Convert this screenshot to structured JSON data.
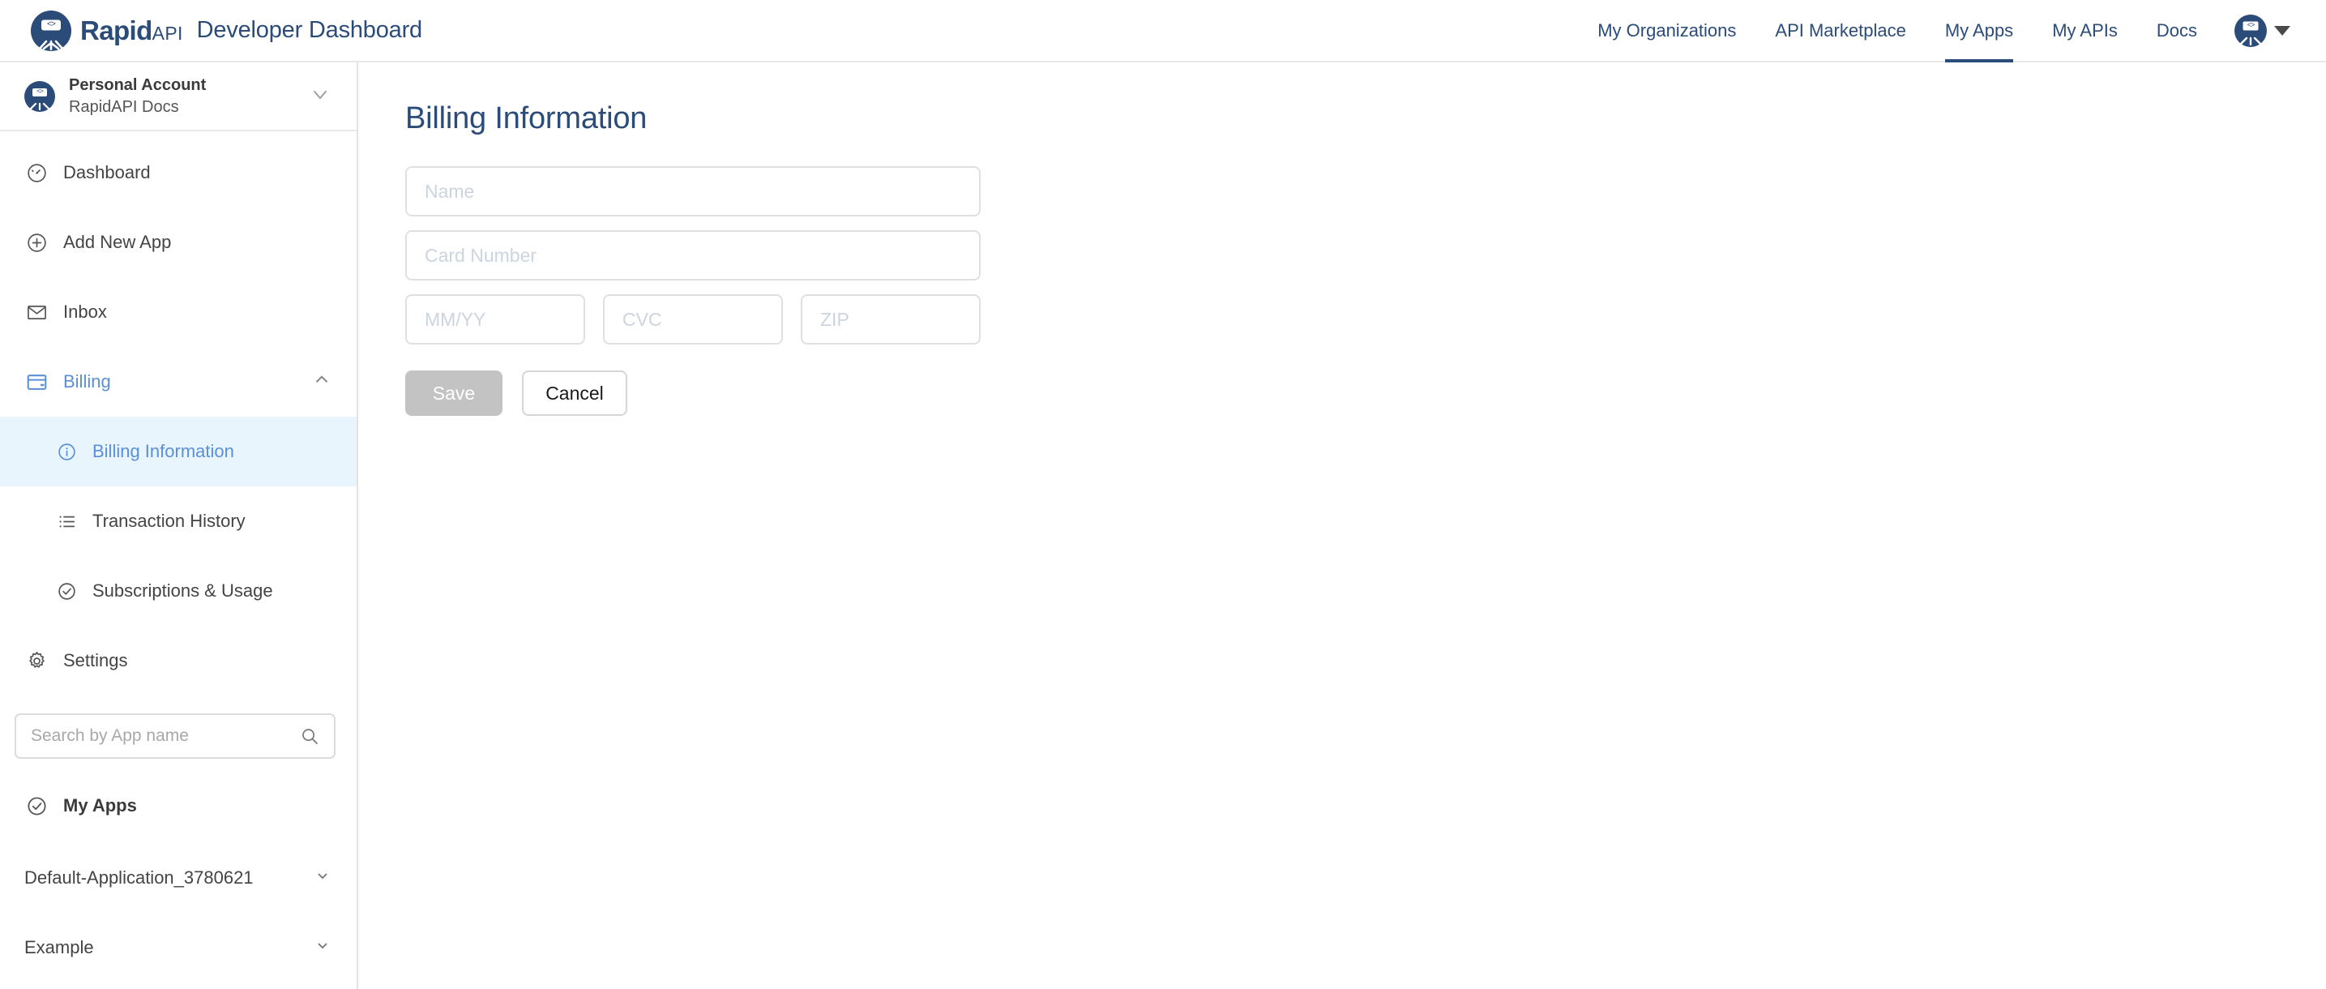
{
  "brand": {
    "logo_icon": "rapidapi-octopus-logo-icon",
    "name_primary": "Rapid",
    "name_secondary": "API",
    "app_title": "Developer Dashboard"
  },
  "topnav": {
    "items": [
      {
        "label": "My Organizations",
        "active": false
      },
      {
        "label": "API Marketplace",
        "active": false
      },
      {
        "label": "My Apps",
        "active": true
      },
      {
        "label": "My APIs",
        "active": false
      },
      {
        "label": "Docs",
        "active": false
      }
    ],
    "avatar_icon": "user-avatar-icon",
    "caret_icon": "caret-down-icon"
  },
  "sidebar": {
    "account": {
      "avatar_icon": "account-avatar-icon",
      "title": "Personal Account",
      "subtitle": "RapidAPI Docs",
      "chevron_icon": "chevron-down-icon"
    },
    "nav": [
      {
        "label": "Dashboard",
        "icon": "speedometer-icon"
      },
      {
        "label": "Add New App",
        "icon": "plus-circle-icon"
      },
      {
        "label": "Inbox",
        "icon": "envelope-icon"
      },
      {
        "label": "Billing",
        "icon": "credit-card-icon"
      }
    ],
    "billing_expanded_chevron": "chevron-up-icon",
    "subnav": [
      {
        "label": "Billing Information",
        "icon": "info-circle-icon"
      },
      {
        "label": "Transaction History",
        "icon": "list-icon"
      },
      {
        "label": "Subscriptions & Usage",
        "icon": "check-circle-icon"
      }
    ],
    "settings": {
      "label": "Settings",
      "icon": "gear-icon"
    },
    "search": {
      "placeholder": "Search by App name",
      "value": "",
      "icon": "search-icon"
    },
    "my_apps": {
      "label": "My Apps",
      "icon": "check-circle-icon"
    },
    "apps": [
      {
        "label": "Default-Application_3780621",
        "chevron_icon": "chevron-down-icon"
      },
      {
        "label": "Example",
        "chevron_icon": "chevron-down-icon"
      }
    ]
  },
  "main": {
    "title": "Billing Information",
    "fields": {
      "name": {
        "placeholder": "Name",
        "value": ""
      },
      "card_number": {
        "placeholder": "Card Number",
        "value": ""
      },
      "expiry": {
        "placeholder": "MM/YY",
        "value": ""
      },
      "cvc": {
        "placeholder": "CVC",
        "value": ""
      },
      "zip": {
        "placeholder": "ZIP",
        "value": ""
      }
    },
    "buttons": {
      "save": "Save",
      "cancel": "Cancel"
    }
  },
  "colors": {
    "brand_navy": "#2b4b79",
    "accent_blue": "#5b8fd8",
    "active_bg": "#e9f5fd",
    "save_disabled": "#c3c3c3",
    "border": "#e0e0e0"
  }
}
